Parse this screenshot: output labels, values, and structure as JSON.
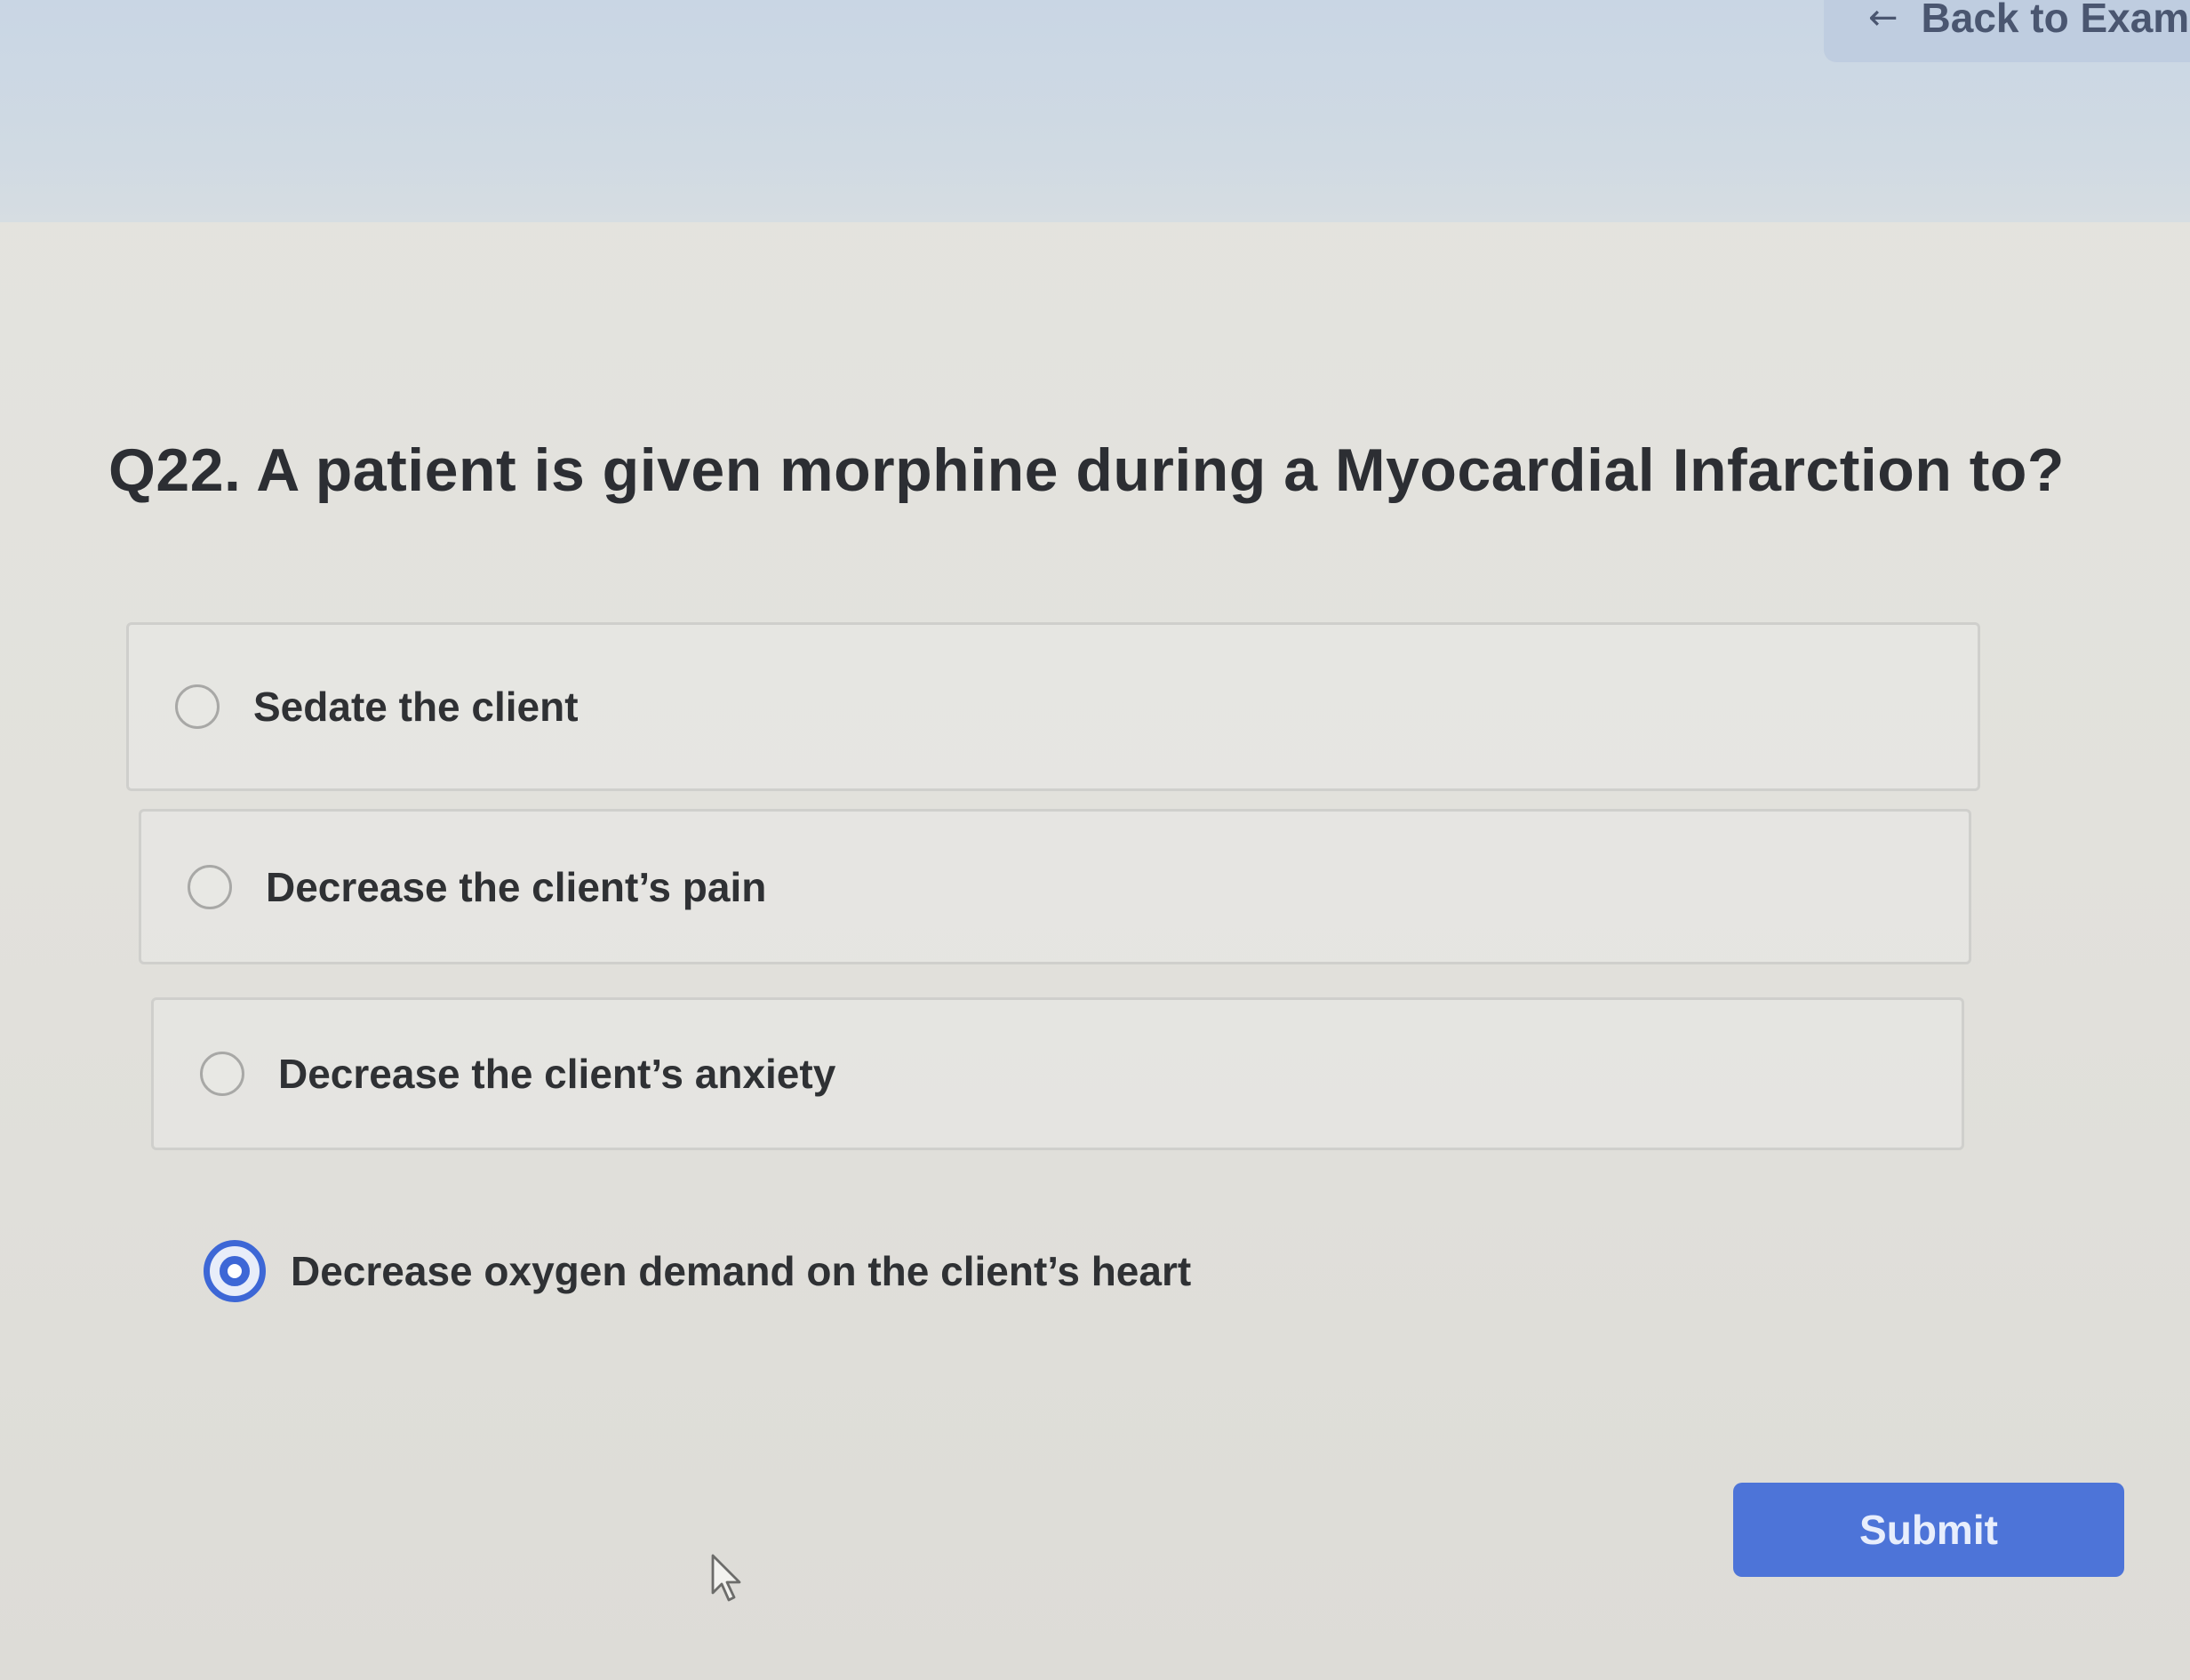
{
  "header": {
    "back_label": "Back to Exam",
    "back_icon": "arrow-left-icon"
  },
  "question": {
    "text": "Q22.  A patient is given morphine during a Myocardial Infarction to?"
  },
  "options": [
    {
      "label": "Sedate the client",
      "selected": false
    },
    {
      "label": "Decrease the client’s pain",
      "selected": false
    },
    {
      "label": "Decrease the client’s anxiety",
      "selected": false
    },
    {
      "label": "Decrease oxygen demand on the client’s heart",
      "selected": true
    }
  ],
  "submit": {
    "label": "Submit"
  },
  "colors": {
    "accent": "#4d74d8",
    "selected_radio": "#3d67d6",
    "text": "#2f3134"
  }
}
